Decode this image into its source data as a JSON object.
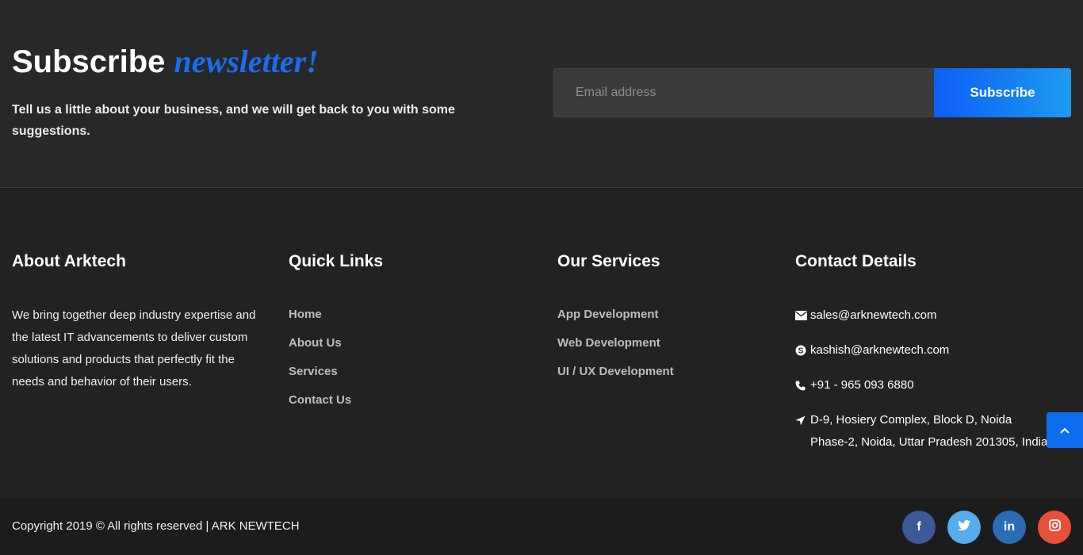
{
  "newsletter": {
    "title_main": "Subscribe",
    "title_accent": "newsletter!",
    "description": "Tell us a little about your business, and we will get back to you with some suggestions.",
    "email_placeholder": "Email address",
    "button_label": "Subscribe",
    "accent_color": "#1a6cf0"
  },
  "about": {
    "title": "About Arktech",
    "text": "We bring together deep industry expertise and the latest IT advancements to deliver custom solutions and products that perfectly fit the needs and behavior of their users."
  },
  "quick_links": {
    "title": "Quick Links",
    "items": [
      "Home",
      "About Us",
      "Services",
      "Contact Us"
    ]
  },
  "services": {
    "title": "Our Services",
    "items": [
      "App Development",
      "Web Development",
      "UI / UX Development"
    ]
  },
  "contact": {
    "title": "Contact Details",
    "email": "sales@arknewtech.com",
    "skype": "kashish@arknewtech.com",
    "phone": "+91 - 965 093 6880",
    "address": "D-9, Hosiery Complex, Block D, Noida Phase-2, Noida, Uttar Pradesh 201305, India"
  },
  "footer": {
    "copyright": "Copyright 2019 © All rights reserved | ARK NEWTECH",
    "social": [
      {
        "icon": "facebook-icon",
        "glyph": "f",
        "color": "#3b5998"
      },
      {
        "icon": "twitter-icon",
        "glyph": "t",
        "color": "#55acee"
      },
      {
        "icon": "linkedin-icon",
        "glyph": "in",
        "color": "#2a6db5"
      },
      {
        "icon": "instagram-icon",
        "glyph": "ig",
        "color": "#e8503a"
      }
    ]
  }
}
